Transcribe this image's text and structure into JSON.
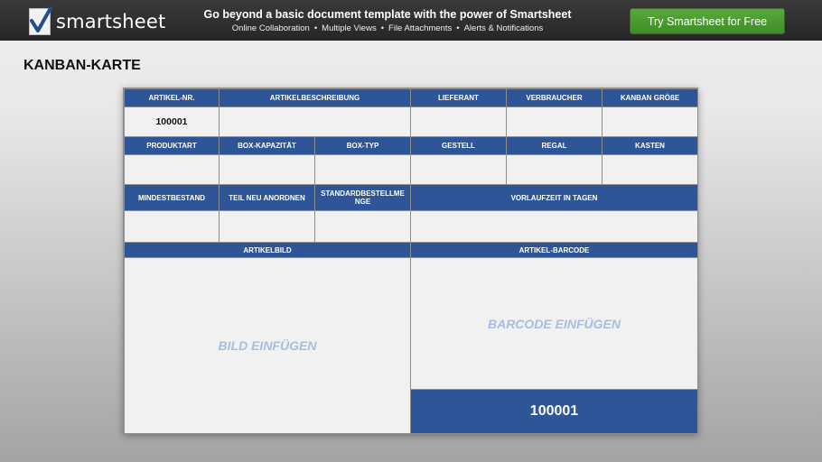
{
  "banner": {
    "logo_text": "smartsheet",
    "tagline": "Go beyond a basic document template with the power of Smartsheet",
    "features": [
      "Online Collaboration",
      "Multiple Views",
      "File Attachments",
      "Alerts & Notifications"
    ],
    "cta_label": "Try Smartsheet for Free",
    "logo_icon": "checkmark-icon",
    "cta_color": "#4a9a33"
  },
  "page": {
    "title": "KANBAN-KARTE"
  },
  "card": {
    "header_color": "#2d5597",
    "row1_headers": [
      "ARTIKEL-NR.",
      "ARTIKELBESCHREIBUNG",
      "LIEFERANT",
      "VERBRAUCHER",
      "KANBAN GRÖßE"
    ],
    "row1_values": [
      "100001",
      "",
      "",
      "",
      ""
    ],
    "row2_headers": [
      "PRODUKTART",
      "BOX-KAPAZITÄT",
      "BOX-TYP",
      "GESTELL",
      "REGAL",
      "KASTEN"
    ],
    "row2_values": [
      "",
      "",
      "",
      "",
      "",
      ""
    ],
    "row3_headers": [
      "MINDESTBESTAND",
      "TEIL NEU ANORDNEN",
      "STANDARDBESTELLME NGE",
      "VORLAUFZEIT IN TAGEN"
    ],
    "row3_values": [
      "",
      "",
      "",
      ""
    ],
    "image_header": "ARTIKELBILD",
    "image_placeholder": "BILD EINFÜGEN",
    "barcode_header": "ARTIKEL-BARCODE",
    "barcode_placeholder": "BARCODE EINFÜGEN",
    "barcode_number": "100001"
  }
}
